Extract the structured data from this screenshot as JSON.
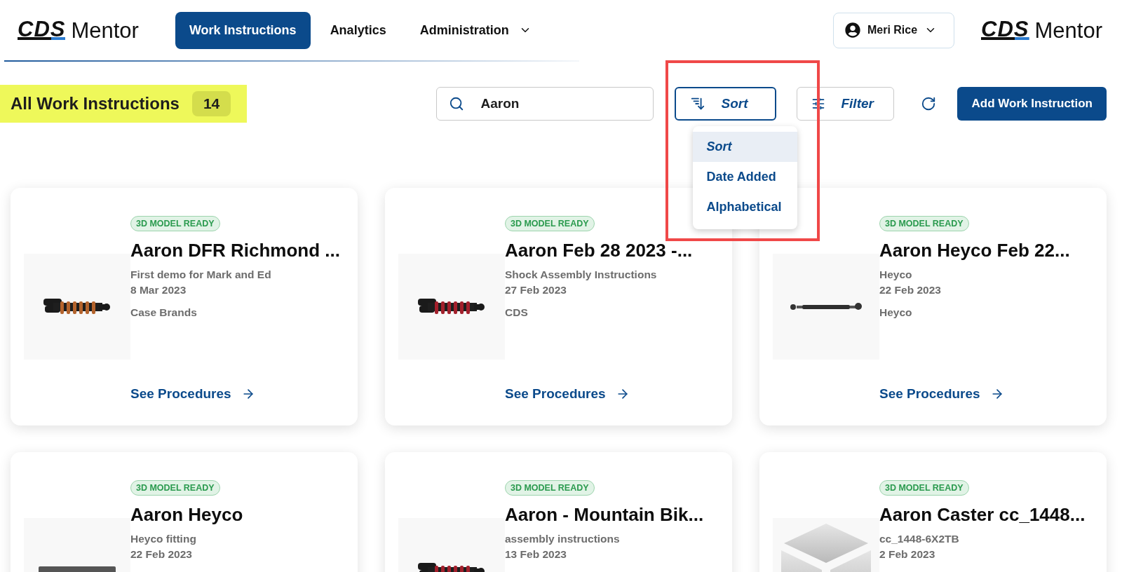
{
  "header": {
    "logo": {
      "mark": "CDS",
      "word": "Mentor"
    },
    "nav": [
      {
        "label": "Work Instructions",
        "selected": true,
        "kind": "link"
      },
      {
        "label": "Analytics",
        "selected": false,
        "kind": "link"
      },
      {
        "label": "Administration",
        "selected": false,
        "kind": "menu"
      }
    ],
    "user": {
      "name": "Meri Rice"
    },
    "logo_right": {
      "mark": "CDS",
      "word": "Mentor"
    }
  },
  "page": {
    "title": "All Work Instructions",
    "count": "14",
    "highlighted": true
  },
  "search": {
    "value": "Aaron"
  },
  "sort": {
    "label": "Sort",
    "expanded": true,
    "annotated": true,
    "options": [
      {
        "label": "Sort",
        "selected": true
      },
      {
        "label": "Date Added",
        "selected": false
      },
      {
        "label": "Alphabetical",
        "selected": false
      }
    ]
  },
  "filter": {
    "label": "Filter"
  },
  "add_button": "Add Work Instruction",
  "cards": [
    {
      "badge": "3D MODEL READY",
      "title": "Aaron DFR Richmond ...",
      "subtitle": "First demo for Mark and Ed",
      "date": "8 Mar 2023",
      "brand": "Case Brands",
      "link": "See Procedures",
      "image": {
        "kind": "shock",
        "color": "#b4632c"
      }
    },
    {
      "badge": "3D MODEL READY",
      "title": "Aaron Feb 28 2023 -...",
      "subtitle": "Shock Assembly Instructions",
      "date": "27 Feb 2023",
      "brand": "CDS",
      "link": "See Procedures",
      "image": {
        "kind": "shock",
        "color": "#a3202c"
      }
    },
    {
      "badge": "3D MODEL READY",
      "title": "Aaron Heyco Feb 22...",
      "subtitle": "Heyco",
      "date": "22 Feb 2023",
      "brand": "Heyco",
      "link": "See Procedures",
      "image": {
        "kind": "rod"
      }
    },
    {
      "badge": "3D MODEL READY",
      "title": "Aaron Heyco",
      "subtitle": "Heyco fitting",
      "date": "22 Feb 2023",
      "image": {
        "kind": "bar"
      }
    },
    {
      "badge": "3D MODEL READY",
      "title": "Aaron - Mountain Bik...",
      "subtitle": "assembly instructions",
      "date": "13 Feb 2023",
      "image": {
        "kind": "shock",
        "color": "#a3202c"
      }
    },
    {
      "badge": "3D MODEL READY",
      "title": "Aaron Caster cc_1448...",
      "subtitle": "cc_1448-6X2TB",
      "date": "2 Feb 2023",
      "image": {
        "kind": "cube"
      }
    }
  ]
}
